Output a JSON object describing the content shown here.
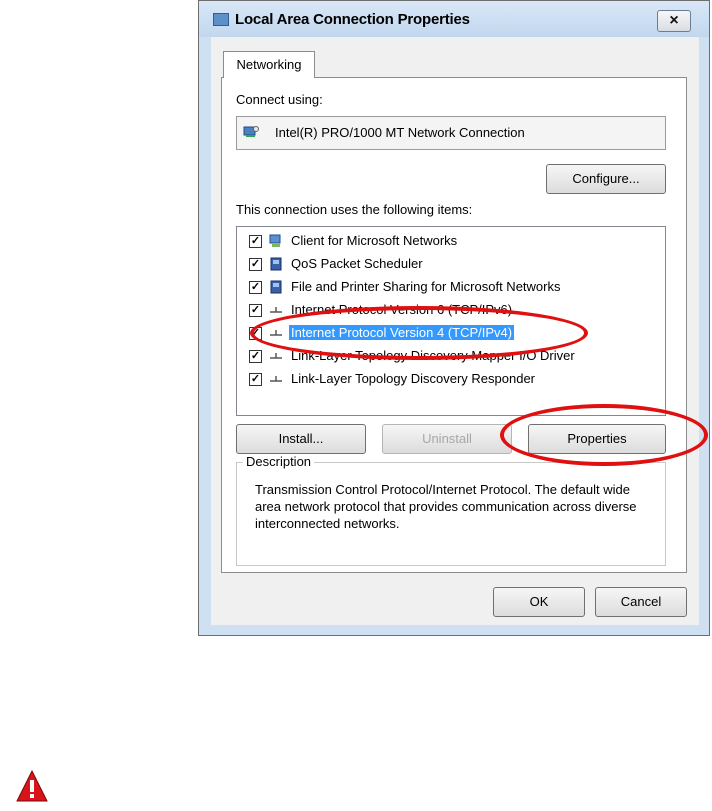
{
  "window": {
    "title": "Local Area Connection Properties",
    "close_label": "×"
  },
  "tabs": [
    {
      "label": "Networking",
      "active": true
    }
  ],
  "connect_using_label": "Connect using:",
  "adapter_name": "Intel(R) PRO/1000 MT Network Connection",
  "configure_label": "Configure...",
  "items_label": "This connection uses the following items:",
  "items": [
    {
      "label": "Client for Microsoft Networks",
      "checked": true,
      "icon": "network-client-icon",
      "selected": false
    },
    {
      "label": "QoS Packet Scheduler",
      "checked": true,
      "icon": "network-service-icon",
      "selected": false
    },
    {
      "label": "File and Printer Sharing for Microsoft Networks",
      "checked": true,
      "icon": "network-service-icon",
      "selected": false
    },
    {
      "label": "Internet Protocol Version 6 (TCP/IPv6)",
      "checked": true,
      "icon": "protocol-icon",
      "selected": false
    },
    {
      "label": "Internet Protocol Version 4 (TCP/IPv4)",
      "checked": true,
      "icon": "protocol-icon",
      "selected": true
    },
    {
      "label": "Link-Layer Topology Discovery Mapper I/O Driver",
      "checked": true,
      "icon": "protocol-icon",
      "selected": false
    },
    {
      "label": "Link-Layer Topology Discovery Responder",
      "checked": true,
      "icon": "protocol-icon",
      "selected": false
    }
  ],
  "buttons": {
    "install": "Install...",
    "uninstall": "Uninstall",
    "properties": "Properties",
    "ok": "OK",
    "cancel": "Cancel"
  },
  "description": {
    "legend": "Description",
    "text": "Transmission Control Protocol/Internet Protocol. The default wide area network protocol that provides communication across diverse interconnected networks."
  },
  "colors": {
    "highlight": "#3399ff",
    "annotation": "#e01010"
  }
}
